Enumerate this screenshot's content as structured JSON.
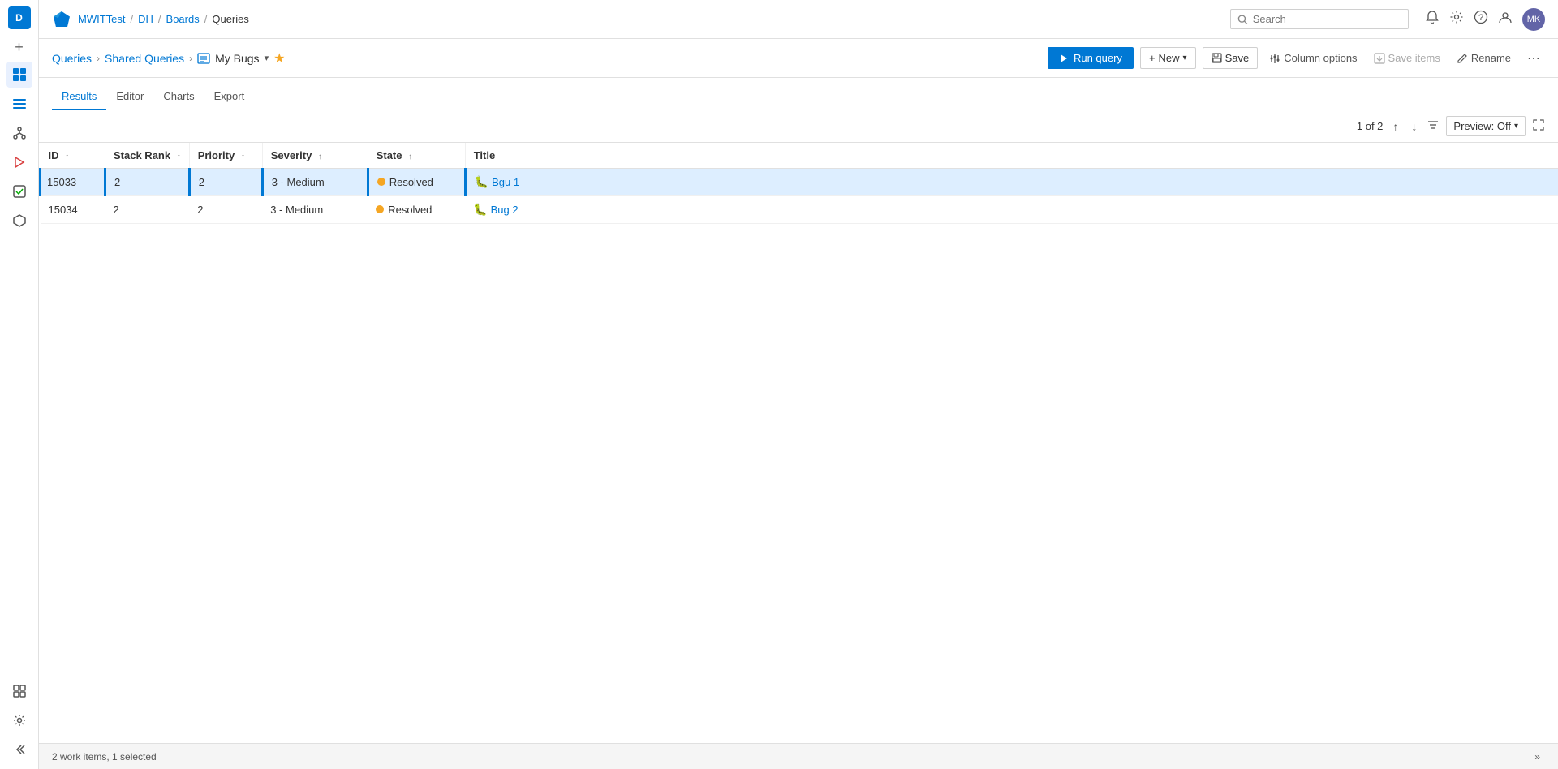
{
  "app": {
    "logo_text": "Azure DevOps",
    "breadcrumb": [
      "MWITTest",
      "DH",
      "Boards",
      "Queries"
    ]
  },
  "search": {
    "placeholder": "Search"
  },
  "sidebar": {
    "avatar_initials": "D",
    "items": [
      {
        "id": "overview",
        "icon": "⊞",
        "label": "Overview"
      },
      {
        "id": "boards",
        "icon": "◧",
        "label": "Boards"
      },
      {
        "id": "repos",
        "icon": "⎇",
        "label": "Repos"
      },
      {
        "id": "pipelines",
        "icon": "▷",
        "label": "Pipelines"
      },
      {
        "id": "testplans",
        "icon": "✓",
        "label": "Test Plans"
      },
      {
        "id": "artifacts",
        "icon": "⬡",
        "label": "Artifacts"
      },
      {
        "id": "more",
        "icon": "⊞",
        "label": "More"
      }
    ],
    "bottom": [
      {
        "id": "settings",
        "icon": "⚙",
        "label": "Settings"
      },
      {
        "id": "collapse",
        "icon": "«",
        "label": "Collapse"
      }
    ]
  },
  "query_nav": {
    "queries_label": "Queries",
    "shared_label": "Shared Queries",
    "query_name": "My Bugs",
    "star_title": "Favorite"
  },
  "toolbar": {
    "run_query_label": "Run query",
    "new_label": "New",
    "save_label": "Save",
    "column_options_label": "Column options",
    "save_items_label": "Save items",
    "rename_label": "Rename",
    "more_label": "..."
  },
  "tabs": {
    "items": [
      "Results",
      "Editor",
      "Charts",
      "Export"
    ],
    "active": "Results"
  },
  "pagination": {
    "text": "1 of 2",
    "preview_label": "Preview: Off"
  },
  "table": {
    "columns": [
      {
        "key": "id",
        "label": "ID"
      },
      {
        "key": "stack_rank",
        "label": "Stack Rank"
      },
      {
        "key": "priority",
        "label": "Priority"
      },
      {
        "key": "severity",
        "label": "Severity"
      },
      {
        "key": "state",
        "label": "State"
      },
      {
        "key": "title",
        "label": "Title"
      }
    ],
    "rows": [
      {
        "id": "15033",
        "stack_rank": "2",
        "priority": "2",
        "severity": "3 - Medium",
        "state": "Resolved",
        "title": "Bgu 1",
        "selected": true
      },
      {
        "id": "15034",
        "stack_rank": "2",
        "priority": "2",
        "severity": "3 - Medium",
        "state": "Resolved",
        "title": "Bug 2",
        "selected": false
      }
    ]
  },
  "statusbar": {
    "work_items_text": "2 work items,",
    "selected_text": "1 selected"
  }
}
